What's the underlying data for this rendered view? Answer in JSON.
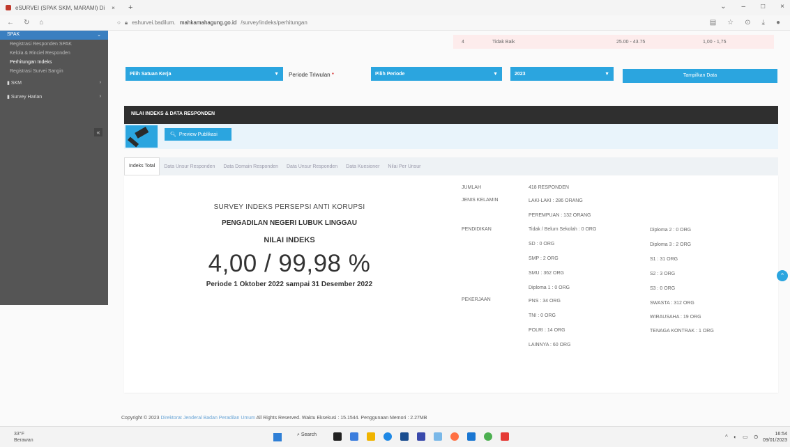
{
  "browser": {
    "tab_title": "eSURVEI (SPAK SKM, MARAMI) Di",
    "url_domain": "mahkamahagung.go.id",
    "url_prefix": "eshurvei.badilum.",
    "url_path": "/survey/indeks/perhitungan"
  },
  "sidebar": {
    "active_group": "SPAK",
    "sub_items": [
      "Registrasi Responden SPAK",
      "Kelola & Rinciel Responden",
      "Perhitungan Indeks",
      "Registrasi Survei Sangin"
    ],
    "menus": [
      "SKM",
      "Survey Harian"
    ],
    "collapse_glyph": "«"
  },
  "top_row": {
    "number": "4",
    "label": "Tidak Baik",
    "range1": "25.00 - 43.75",
    "range2": "1,00 - 1,75"
  },
  "filters": {
    "satuan_kerja": "Pilih Satuan Kerja",
    "periode_label": "Periode Triwulan",
    "periode_value": "Pilih Periode",
    "year_value": "2023",
    "button": "Tampilkan Data"
  },
  "panel": {
    "header": "NILAI INDEKS & DATA RESPONDEN",
    "preview_button": "Preview Publikasi"
  },
  "tabs": [
    "Indeks Total",
    "Data Unsur Responden",
    "Data Domain Responden",
    "Data Unsur Responden",
    "Data Kuesioner",
    "Nilai Per Unsur"
  ],
  "summary": {
    "title": "SURVEY INDEKS PERSEPSI ANTI KORUPSI",
    "court": "PENGADILAN NEGERI LUBUK LINGGAU",
    "index_label": "NILAI INDEKS",
    "index_value": "4,00 / 99,98 %",
    "period": "Periode 1 Oktober 2022 sampai 31 Desember 2022"
  },
  "stats": {
    "jumlah_label": "JUMLAH",
    "jumlah_value": "418 RESPONDEN",
    "jk_label": "JENIS KELAMIN",
    "jk_laki": "LAKI-LAKI : 286 ORANG",
    "jk_perempuan": "PEREMPUAN : 132 ORANG",
    "pendidikan_label": "PENDIDIKAN",
    "pend_col1": [
      "Tidak / Belum Sekolah : 0 ORG",
      "SD : 0 ORG",
      "SMP : 2 ORG",
      "SMU : 362 ORG",
      "Diploma 1 : 0 ORG"
    ],
    "pend_col2": [
      "Diploma 2 : 0 ORG",
      "Diploma 3 : 2 ORG",
      "S1 : 31 ORG",
      "S2 : 3 ORG",
      "S3 : 0 ORG"
    ],
    "pekerjaan_label": "PEKERJAAN",
    "pek_col1": [
      "PNS : 34 ORG",
      "TNI : 0 ORG",
      "POLRI : 14 ORG",
      "LAINNYA : 60 ORG"
    ],
    "pek_col2": [
      "SWASTA : 312 ORG",
      "WIRAUSAHA : 19 ORG",
      "TENAGA KONTRAK : 1 ORG"
    ]
  },
  "footer": {
    "copyright": "Copyright © 2023",
    "link": "Direktorat Jenderal Badan Peradilan Umum",
    "rest": "All Rights Reserved. Waktu Eksekusi : 15.1544. Penggunaan Memori : 2.27MB"
  },
  "taskbar": {
    "weather_temp": "33°F",
    "weather_desc": "Berawan",
    "search": "Search",
    "time": "16:54",
    "date": "09/01/2023"
  },
  "colors": {
    "accent": "#2ba5df",
    "sidebar": "#555555",
    "panel_head": "#2f2f2f"
  }
}
